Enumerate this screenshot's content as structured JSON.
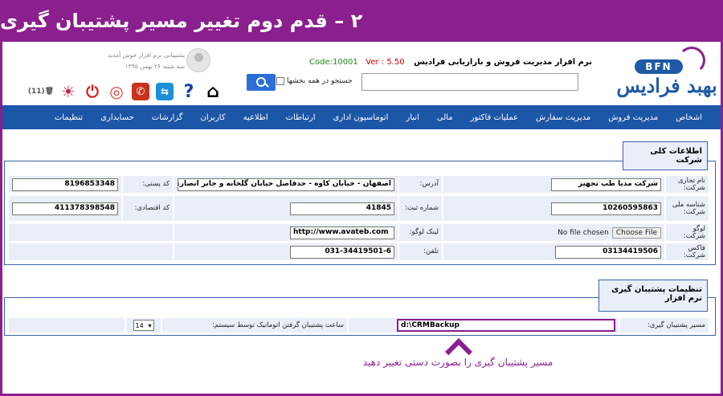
{
  "banner": {
    "title": "۲ – قدم دوم تغییر مسیر پشتیبان گیری"
  },
  "logo": {
    "badge": "BFN",
    "text": "بهبد فرادیس"
  },
  "header": {
    "app_name": "نرم افزار مدیریت فروش و بازاریابی فرادیس",
    "code": "Code:10001",
    "version": "Ver : 5.50",
    "search_placeholder": "",
    "search_all_label": "جستجو در همه بخشها",
    "welcome": "پشتیبانی نرم افزار خوش آمدید",
    "date": "سه شنبه ۲۶ بهمن ۱۳۹۵",
    "trash_count": "(11)"
  },
  "menu": {
    "items": [
      "اشخاص",
      "مدیریت فروش",
      "مدیریت سفارش",
      "عملیات فاکتور",
      "مالی",
      "انبار",
      "اتوماسیون اداری",
      "ارتباطات",
      "اطلاعیه",
      "کاربران",
      "گزارشات",
      "حسابداری",
      "تنظیمات"
    ]
  },
  "company": {
    "section_title": "اطلاعات کلی شرکت",
    "labels": {
      "trade_name": "نام تجاری شرکت:",
      "address": "آدرس:",
      "postal": "کد پستی:",
      "national_id": "شناسه ملی شرکت:",
      "reg_no": "شماره ثبت:",
      "economic_code": "کد اقتصادی:",
      "logo": "لوگو شرکت:",
      "logo_link": "لینک لوگو:",
      "fax": "فاکس شرکت:",
      "phone": "تلفن:"
    },
    "values": {
      "trade_name": "شرکت مدیا طب تجهیز",
      "address": "اصفهان - خیابان کاوه - حدفاصل خیابان گلخانه و جابر انصاری - ب",
      "postal": "8196853348",
      "national_id": "10260595863",
      "reg_no": "41845",
      "economic_code": "411378398548",
      "file_status": "No file chosen",
      "file_button": "Choose File",
      "logo_link": "http://www.avateb.com",
      "fax": "03134419506",
      "phone": "031-34419501-6"
    }
  },
  "backup": {
    "section_title": "تنظیمات پشتیبان گیری نرم افزار",
    "path_label": "مسیر پشتیبان گیری:",
    "path_value": "d:\\CRMBackup",
    "time_label": "ساعت پشتیبان گرفتن اتوماتیک توسط سیستم:",
    "time_value": "14"
  },
  "caption": "مسیر پشتیبان گیری را بصورت دستی تغییر دهید",
  "colors": {
    "accent": "#8a1f8e",
    "menu": "#1c56a7"
  }
}
